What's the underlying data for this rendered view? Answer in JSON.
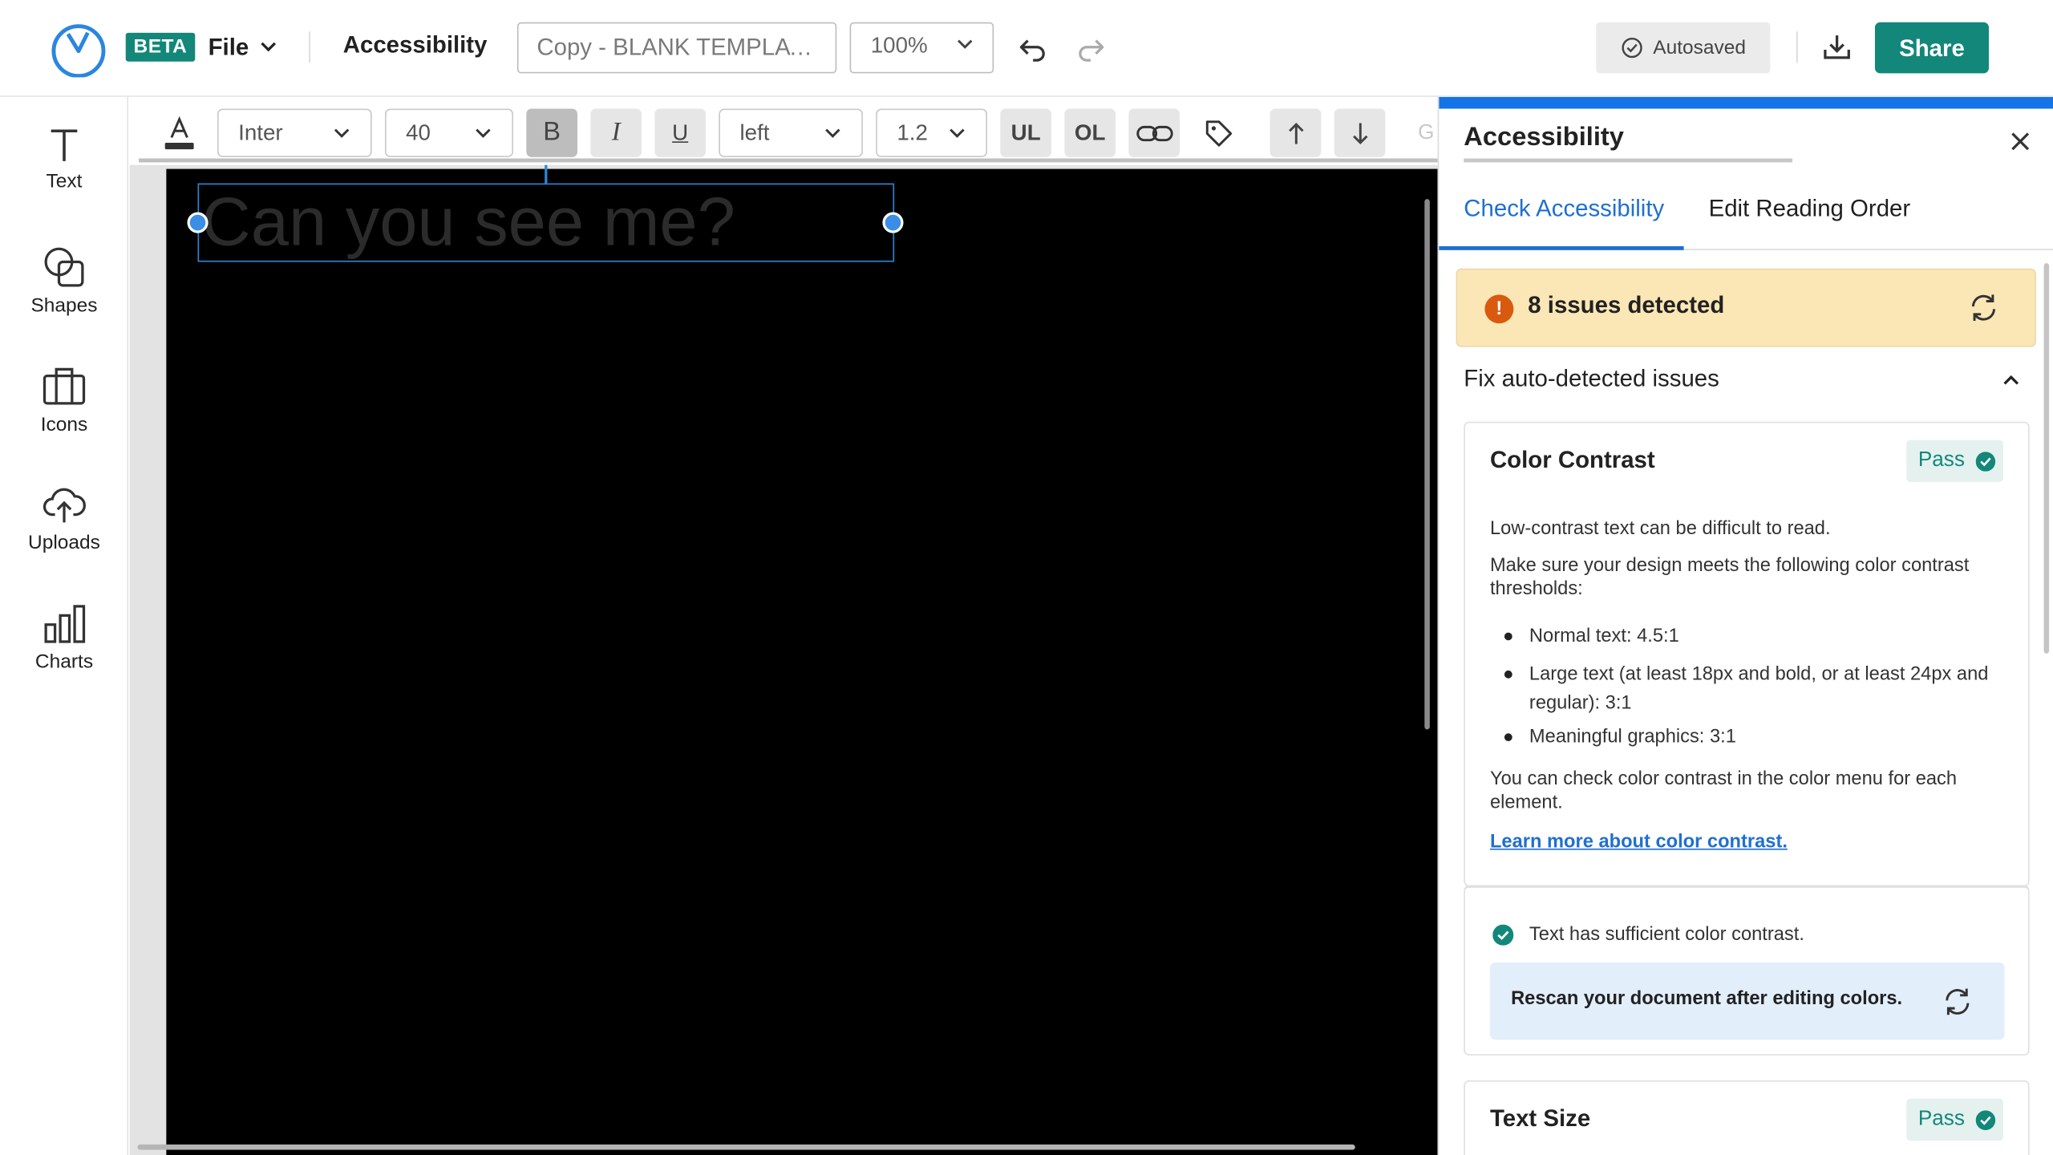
{
  "header": {
    "beta_label": "BETA",
    "file_label": "File",
    "section_label": "Accessibility",
    "document_name": "Copy - BLANK TEMPLATE",
    "zoom": "100%",
    "autosave_status": "Autosaved",
    "share_label": "Share",
    "brand_color": "#12877a"
  },
  "sidebar": {
    "tools": [
      {
        "label": "Text",
        "icon": "text-icon"
      },
      {
        "label": "Shapes",
        "icon": "shapes-icon"
      },
      {
        "label": "Icons",
        "icon": "briefcase-icon"
      },
      {
        "label": "Uploads",
        "icon": "cloud-upload-icon"
      },
      {
        "label": "Charts",
        "icon": "bar-chart-icon"
      }
    ]
  },
  "format_toolbar": {
    "font_family": "Inter",
    "font_size": "40",
    "bold": "B",
    "italic": "I",
    "underline": "U",
    "alignment": "left",
    "line_height": "1.2",
    "unordered_list": "UL",
    "ordered_list": "OL",
    "truncated_label": "G"
  },
  "canvas": {
    "text_content": "Can you see me?",
    "page_background": "#000000",
    "text_color": "#2b2b2b"
  },
  "accessibility_panel": {
    "title": "Accessibility",
    "tabs": [
      {
        "label": "Check Accessibility",
        "active": true
      },
      {
        "label": "Edit Reading Order",
        "active": false
      }
    ],
    "issues_summary": "8 issues detected",
    "issues_icon": "!",
    "fix_section_title": "Fix auto-detected issues",
    "cards": [
      {
        "title": "Color Contrast",
        "status": "Pass",
        "intro": "Low-contrast text can be difficult to read.",
        "thresholds_intro": "Make sure your design meets the following color contrast thresholds:",
        "thresholds": [
          "Normal text: 4.5:1",
          "Large text (at least 18px and bold, or at least 24px and regular): 3:1",
          "Meaningful graphics: 3:1"
        ],
        "note": "You can check color contrast in the color menu for each element.",
        "link": "Learn more about color contrast.",
        "result": "Text has sufficient color contrast.",
        "rescan_note": "Rescan your document after editing colors."
      },
      {
        "title": "Text Size",
        "status": "Pass"
      }
    ],
    "warning_color": "#fbe6b5",
    "link_color": "#1f6fd1"
  }
}
